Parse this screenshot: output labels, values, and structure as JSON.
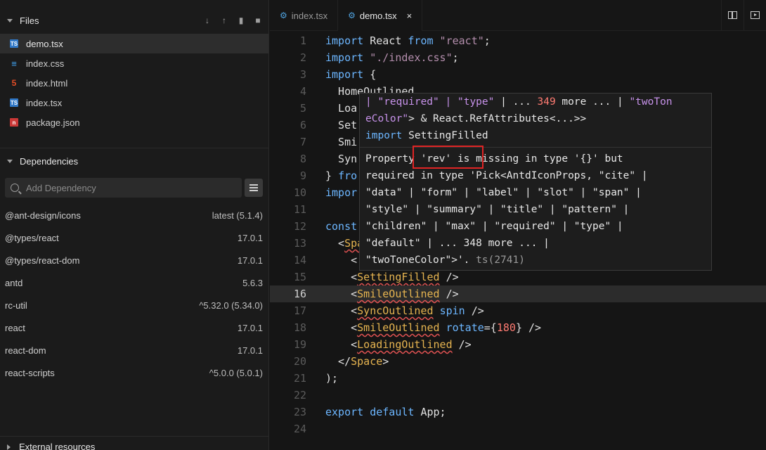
{
  "sidebar": {
    "files_title": "Files",
    "files": [
      {
        "name": "demo.tsx",
        "type": "TS",
        "active": true
      },
      {
        "name": "index.css",
        "type": "CSS"
      },
      {
        "name": "index.html",
        "type": "HTML"
      },
      {
        "name": "index.tsx",
        "type": "TS"
      },
      {
        "name": "package.json",
        "type": "JSON"
      }
    ],
    "deps_title": "Dependencies",
    "search_placeholder": "Add Dependency",
    "dependencies": [
      {
        "name": "@ant-design/icons",
        "version": "latest (5.1.4)"
      },
      {
        "name": "@types/react",
        "version": "17.0.1"
      },
      {
        "name": "@types/react-dom",
        "version": "17.0.1"
      },
      {
        "name": "antd",
        "version": "5.6.3"
      },
      {
        "name": "rc-util",
        "version": "^5.32.0 (5.34.0)"
      },
      {
        "name": "react",
        "version": "17.0.1"
      },
      {
        "name": "react-dom",
        "version": "17.0.1"
      },
      {
        "name": "react-scripts",
        "version": "^5.0.0 (5.0.1)"
      }
    ],
    "external_title": "External resources"
  },
  "tabs": [
    {
      "label": "index.tsx",
      "active": false
    },
    {
      "label": "demo.tsx",
      "active": true
    }
  ],
  "close_glyph": "×",
  "editor": {
    "current_line": 16,
    "line_numbers": [
      "1",
      "2",
      "3",
      "4",
      "5",
      "6",
      "7",
      "8",
      "9",
      "10",
      "11",
      "12",
      "13",
      "14",
      "15",
      "16",
      "17",
      "18",
      "19",
      "20",
      "21",
      "22",
      "23",
      "24"
    ],
    "lines": {
      "l1": [
        "import",
        " React ",
        "from",
        " \"react\"",
        ";"
      ],
      "l2": [
        "import",
        " \"./index.css\"",
        ";"
      ],
      "l3": [
        "import",
        " {"
      ],
      "l4": "  HomeOutlined",
      "l5": "  Loa",
      "l6": "  Set",
      "l7": "  Smi",
      "l8": "  Syn",
      "l9": [
        "} ",
        "fro"
      ],
      "l10": "impor",
      "l12": "const",
      "l13": [
        "  <",
        "Spa"
      ],
      "l14": "    <",
      "l15": [
        "    <",
        "SettingFilled",
        " />"
      ],
      "l16": [
        "    <",
        "SmileOutlined",
        " />"
      ],
      "l17": [
        "    <",
        "SyncOutlined",
        " ",
        "spin",
        " />"
      ],
      "l18": [
        "    <",
        "SmileOutlined",
        " ",
        "rotate",
        "={",
        "180",
        "} />"
      ],
      "l19": [
        "    <",
        "LoadingOutlined",
        " />"
      ],
      "l20": [
        "  </",
        "Space",
        ">"
      ],
      "l21": ");",
      "l23": [
        "export",
        " ",
        "default",
        " App;"
      ]
    }
  },
  "tooltip": {
    "top_lines": [
      [
        "| ",
        "\"required\"",
        " | ",
        "\"type\"",
        " | ... ",
        "349",
        " more ... | ",
        "\"twoTon"
      ],
      [
        "eColor\"",
        "> & React.RefAttributes<...>>"
      ],
      [
        "import",
        " SettingFilled"
      ]
    ],
    "message_lines": [
      "Property 'rev' is missing in type '{}' but",
      "required in type 'Pick<AntdIconProps, \"cite\" |",
      "\"data\" | \"form\" | \"label\" | \"slot\" | \"span\" |",
      "\"style\" | \"summary\" | \"title\" | \"pattern\" |",
      "\"children\" | \"max\" | \"required\" | \"type\" |",
      "\"default\" | ... 348 more ... |",
      "\"twoToneColor\">'."
    ],
    "code": "ts(2741)"
  }
}
